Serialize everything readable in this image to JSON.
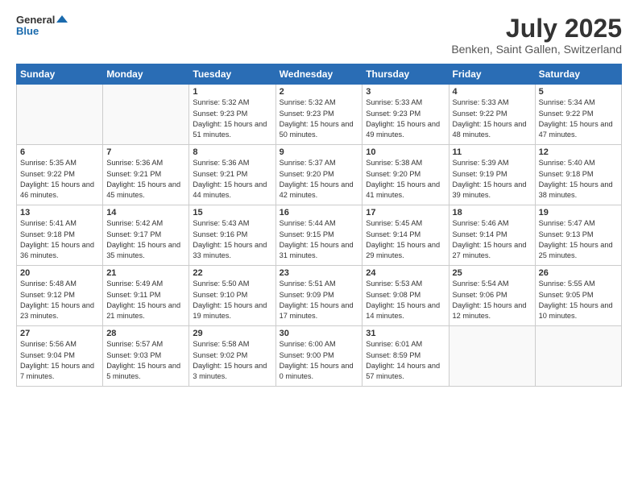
{
  "header": {
    "logo_general": "General",
    "logo_blue": "Blue",
    "month": "July 2025",
    "location": "Benken, Saint Gallen, Switzerland"
  },
  "days_of_week": [
    "Sunday",
    "Monday",
    "Tuesday",
    "Wednesday",
    "Thursday",
    "Friday",
    "Saturday"
  ],
  "weeks": [
    [
      {
        "day": "",
        "sunrise": "",
        "sunset": "",
        "daylight": ""
      },
      {
        "day": "",
        "sunrise": "",
        "sunset": "",
        "daylight": ""
      },
      {
        "day": "1",
        "sunrise": "Sunrise: 5:32 AM",
        "sunset": "Sunset: 9:23 PM",
        "daylight": "Daylight: 15 hours and 51 minutes."
      },
      {
        "day": "2",
        "sunrise": "Sunrise: 5:32 AM",
        "sunset": "Sunset: 9:23 PM",
        "daylight": "Daylight: 15 hours and 50 minutes."
      },
      {
        "day": "3",
        "sunrise": "Sunrise: 5:33 AM",
        "sunset": "Sunset: 9:23 PM",
        "daylight": "Daylight: 15 hours and 49 minutes."
      },
      {
        "day": "4",
        "sunrise": "Sunrise: 5:33 AM",
        "sunset": "Sunset: 9:22 PM",
        "daylight": "Daylight: 15 hours and 48 minutes."
      },
      {
        "day": "5",
        "sunrise": "Sunrise: 5:34 AM",
        "sunset": "Sunset: 9:22 PM",
        "daylight": "Daylight: 15 hours and 47 minutes."
      }
    ],
    [
      {
        "day": "6",
        "sunrise": "Sunrise: 5:35 AM",
        "sunset": "Sunset: 9:22 PM",
        "daylight": "Daylight: 15 hours and 46 minutes."
      },
      {
        "day": "7",
        "sunrise": "Sunrise: 5:36 AM",
        "sunset": "Sunset: 9:21 PM",
        "daylight": "Daylight: 15 hours and 45 minutes."
      },
      {
        "day": "8",
        "sunrise": "Sunrise: 5:36 AM",
        "sunset": "Sunset: 9:21 PM",
        "daylight": "Daylight: 15 hours and 44 minutes."
      },
      {
        "day": "9",
        "sunrise": "Sunrise: 5:37 AM",
        "sunset": "Sunset: 9:20 PM",
        "daylight": "Daylight: 15 hours and 42 minutes."
      },
      {
        "day": "10",
        "sunrise": "Sunrise: 5:38 AM",
        "sunset": "Sunset: 9:20 PM",
        "daylight": "Daylight: 15 hours and 41 minutes."
      },
      {
        "day": "11",
        "sunrise": "Sunrise: 5:39 AM",
        "sunset": "Sunset: 9:19 PM",
        "daylight": "Daylight: 15 hours and 39 minutes."
      },
      {
        "day": "12",
        "sunrise": "Sunrise: 5:40 AM",
        "sunset": "Sunset: 9:18 PM",
        "daylight": "Daylight: 15 hours and 38 minutes."
      }
    ],
    [
      {
        "day": "13",
        "sunrise": "Sunrise: 5:41 AM",
        "sunset": "Sunset: 9:18 PM",
        "daylight": "Daylight: 15 hours and 36 minutes."
      },
      {
        "day": "14",
        "sunrise": "Sunrise: 5:42 AM",
        "sunset": "Sunset: 9:17 PM",
        "daylight": "Daylight: 15 hours and 35 minutes."
      },
      {
        "day": "15",
        "sunrise": "Sunrise: 5:43 AM",
        "sunset": "Sunset: 9:16 PM",
        "daylight": "Daylight: 15 hours and 33 minutes."
      },
      {
        "day": "16",
        "sunrise": "Sunrise: 5:44 AM",
        "sunset": "Sunset: 9:15 PM",
        "daylight": "Daylight: 15 hours and 31 minutes."
      },
      {
        "day": "17",
        "sunrise": "Sunrise: 5:45 AM",
        "sunset": "Sunset: 9:14 PM",
        "daylight": "Daylight: 15 hours and 29 minutes."
      },
      {
        "day": "18",
        "sunrise": "Sunrise: 5:46 AM",
        "sunset": "Sunset: 9:14 PM",
        "daylight": "Daylight: 15 hours and 27 minutes."
      },
      {
        "day": "19",
        "sunrise": "Sunrise: 5:47 AM",
        "sunset": "Sunset: 9:13 PM",
        "daylight": "Daylight: 15 hours and 25 minutes."
      }
    ],
    [
      {
        "day": "20",
        "sunrise": "Sunrise: 5:48 AM",
        "sunset": "Sunset: 9:12 PM",
        "daylight": "Daylight: 15 hours and 23 minutes."
      },
      {
        "day": "21",
        "sunrise": "Sunrise: 5:49 AM",
        "sunset": "Sunset: 9:11 PM",
        "daylight": "Daylight: 15 hours and 21 minutes."
      },
      {
        "day": "22",
        "sunrise": "Sunrise: 5:50 AM",
        "sunset": "Sunset: 9:10 PM",
        "daylight": "Daylight: 15 hours and 19 minutes."
      },
      {
        "day": "23",
        "sunrise": "Sunrise: 5:51 AM",
        "sunset": "Sunset: 9:09 PM",
        "daylight": "Daylight: 15 hours and 17 minutes."
      },
      {
        "day": "24",
        "sunrise": "Sunrise: 5:53 AM",
        "sunset": "Sunset: 9:08 PM",
        "daylight": "Daylight: 15 hours and 14 minutes."
      },
      {
        "day": "25",
        "sunrise": "Sunrise: 5:54 AM",
        "sunset": "Sunset: 9:06 PM",
        "daylight": "Daylight: 15 hours and 12 minutes."
      },
      {
        "day": "26",
        "sunrise": "Sunrise: 5:55 AM",
        "sunset": "Sunset: 9:05 PM",
        "daylight": "Daylight: 15 hours and 10 minutes."
      }
    ],
    [
      {
        "day": "27",
        "sunrise": "Sunrise: 5:56 AM",
        "sunset": "Sunset: 9:04 PM",
        "daylight": "Daylight: 15 hours and 7 minutes."
      },
      {
        "day": "28",
        "sunrise": "Sunrise: 5:57 AM",
        "sunset": "Sunset: 9:03 PM",
        "daylight": "Daylight: 15 hours and 5 minutes."
      },
      {
        "day": "29",
        "sunrise": "Sunrise: 5:58 AM",
        "sunset": "Sunset: 9:02 PM",
        "daylight": "Daylight: 15 hours and 3 minutes."
      },
      {
        "day": "30",
        "sunrise": "Sunrise: 6:00 AM",
        "sunset": "Sunset: 9:00 PM",
        "daylight": "Daylight: 15 hours and 0 minutes."
      },
      {
        "day": "31",
        "sunrise": "Sunrise: 6:01 AM",
        "sunset": "Sunset: 8:59 PM",
        "daylight": "Daylight: 14 hours and 57 minutes."
      },
      {
        "day": "",
        "sunrise": "",
        "sunset": "",
        "daylight": ""
      },
      {
        "day": "",
        "sunrise": "",
        "sunset": "",
        "daylight": ""
      }
    ]
  ]
}
